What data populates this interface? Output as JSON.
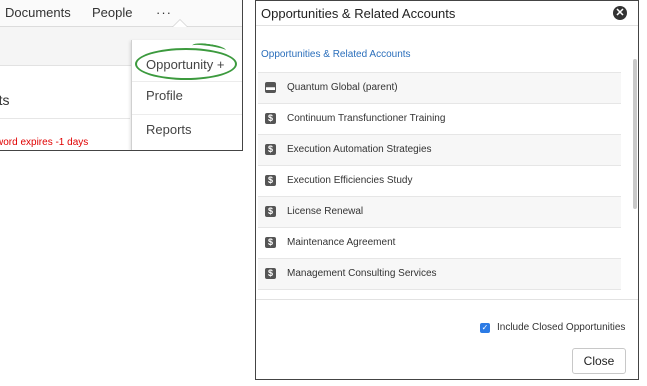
{
  "left": {
    "nav": {
      "documents": "Documents",
      "people": "People",
      "more": "···"
    },
    "section_title": "rts",
    "password_warning": "word expires -1 days",
    "dropdown": {
      "opportunity": "Opportunity +",
      "profile": "Profile",
      "reports": "Reports"
    },
    "highlight_color": "#3c9a3e"
  },
  "dialog": {
    "title": "Opportunities & Related Accounts",
    "subtitle": "Opportunities & Related Accounts",
    "items": [
      {
        "icon": "account-icon",
        "label": "Quantum Global (parent)"
      },
      {
        "icon": "dollar-icon",
        "label": "Continuum Transfunctioner Training"
      },
      {
        "icon": "dollar-icon",
        "label": "Execution Automation Strategies"
      },
      {
        "icon": "dollar-icon",
        "label": "Execution Efficiencies Study"
      },
      {
        "icon": "dollar-icon",
        "label": "License Renewal"
      },
      {
        "icon": "dollar-icon",
        "label": "Maintenance Agreement"
      },
      {
        "icon": "dollar-icon",
        "label": "Management Consulting Services"
      }
    ],
    "include_closed_label": "Include Closed Opportunities",
    "include_closed_checked": true,
    "close_label": "Close",
    "link_color": "#2a6ebb",
    "checkbox_color": "#2c7be5"
  }
}
